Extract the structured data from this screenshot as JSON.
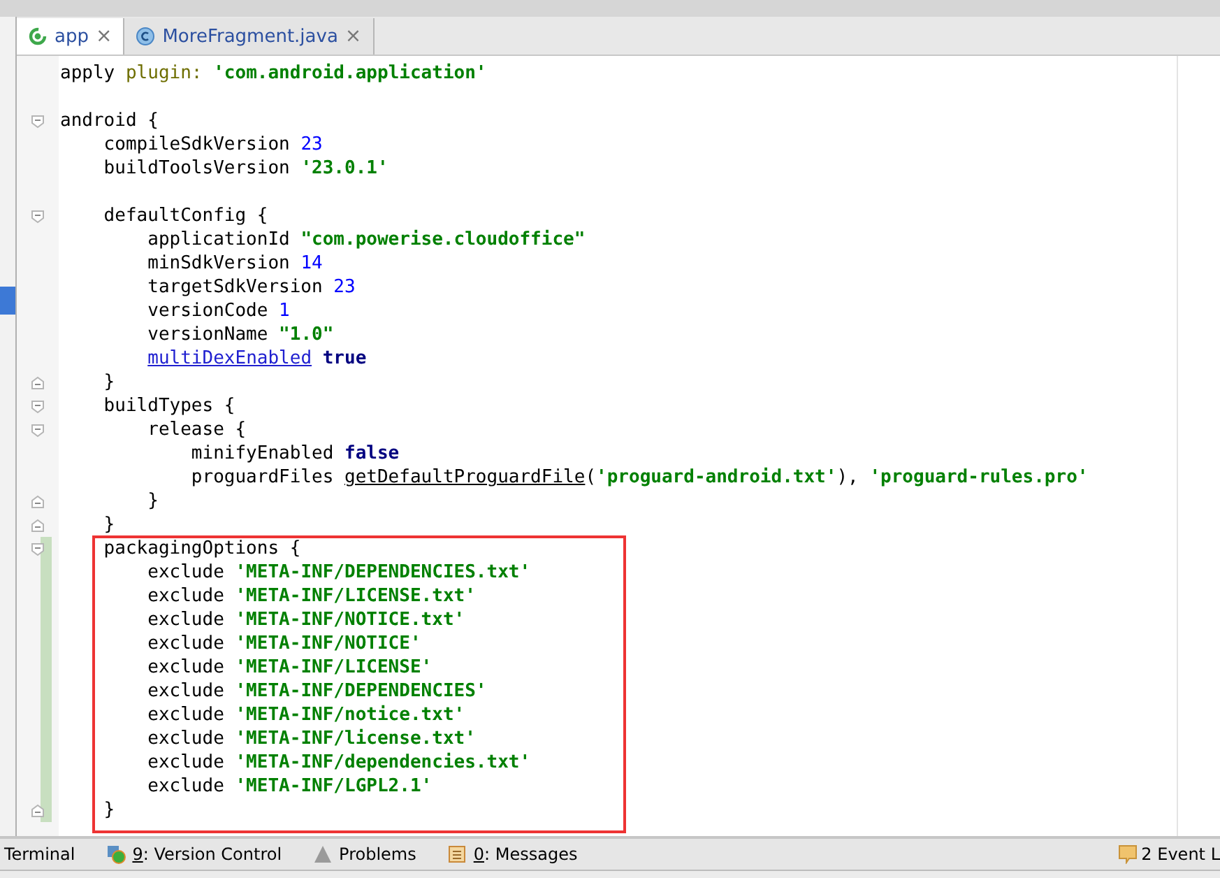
{
  "tabs": [
    {
      "label": "app",
      "kind": "gradle",
      "close": "×",
      "selected": true
    },
    {
      "label": "MoreFragment.java",
      "kind": "class",
      "close": "×",
      "selected": false
    }
  ],
  "code": {
    "lines": [
      {
        "kind": "code",
        "tokens": [
          {
            "kind": "plain",
            "text": "apply "
          },
          {
            "kind": "label",
            "text": "plugin: "
          },
          {
            "kind": "string",
            "text": "'com.android.application'"
          }
        ]
      },
      {
        "kind": "blank"
      },
      {
        "kind": "fold-open",
        "tokens": [
          {
            "kind": "plain",
            "text": "android {"
          }
        ]
      },
      {
        "kind": "code",
        "tokens": [
          {
            "kind": "plain",
            "text": "    compileSdkVersion "
          },
          {
            "kind": "number",
            "text": "23"
          }
        ]
      },
      {
        "kind": "code",
        "tokens": [
          {
            "kind": "plain",
            "text": "    buildToolsVersion "
          },
          {
            "kind": "string",
            "text": "'23.0.1'"
          }
        ]
      },
      {
        "kind": "blank"
      },
      {
        "kind": "fold-open",
        "tokens": [
          {
            "kind": "plain",
            "text": "    defaultConfig {"
          }
        ]
      },
      {
        "kind": "code",
        "tokens": [
          {
            "kind": "plain",
            "text": "        applicationId "
          },
          {
            "kind": "string",
            "text": "\"com.powerise.cloudoffice\""
          }
        ]
      },
      {
        "kind": "code",
        "tokens": [
          {
            "kind": "plain",
            "text": "        minSdkVersion "
          },
          {
            "kind": "number",
            "text": "14"
          }
        ]
      },
      {
        "kind": "code",
        "tokens": [
          {
            "kind": "plain",
            "text": "        targetSdkVersion "
          },
          {
            "kind": "number",
            "text": "23"
          }
        ]
      },
      {
        "kind": "code",
        "tokens": [
          {
            "kind": "plain",
            "text": "        versionCode "
          },
          {
            "kind": "number",
            "text": "1"
          }
        ]
      },
      {
        "kind": "code",
        "tokens": [
          {
            "kind": "plain",
            "text": "        versionName "
          },
          {
            "kind": "string",
            "text": "\"1.0\""
          }
        ]
      },
      {
        "kind": "code",
        "tokens": [
          {
            "kind": "link",
            "text": "        multiDexEnabled"
          },
          {
            "kind": "keyword",
            "text": " true"
          }
        ]
      },
      {
        "kind": "fold-close",
        "tokens": [
          {
            "kind": "plain",
            "text": "    }"
          }
        ]
      },
      {
        "kind": "fold-open",
        "tokens": [
          {
            "kind": "plain",
            "text": "    buildTypes {"
          }
        ]
      },
      {
        "kind": "fold-open",
        "tokens": [
          {
            "kind": "plain",
            "text": "        release {"
          }
        ]
      },
      {
        "kind": "code",
        "tokens": [
          {
            "kind": "plain",
            "text": "            minifyEnabled "
          },
          {
            "kind": "keyword",
            "text": "false"
          }
        ]
      },
      {
        "kind": "code",
        "tokens": [
          {
            "kind": "plain",
            "text": "            proguardFiles "
          },
          {
            "kind": "method",
            "text": "getDefaultProguardFile"
          },
          {
            "kind": "plain",
            "text": "("
          },
          {
            "kind": "string",
            "text": "'proguard-android.txt'"
          },
          {
            "kind": "plain",
            "text": "), "
          },
          {
            "kind": "string",
            "text": "'proguard-rules.pro'"
          }
        ]
      },
      {
        "kind": "fold-close",
        "tokens": [
          {
            "kind": "plain",
            "text": "        }"
          }
        ]
      },
      {
        "kind": "fold-close",
        "tokens": [
          {
            "kind": "plain",
            "text": "    }"
          }
        ]
      }
    ],
    "boxed_lines": [
      {
        "kind": "fold-open",
        "tokens": [
          {
            "kind": "plain",
            "text": "    packagingOptions {"
          }
        ]
      },
      {
        "kind": "code",
        "tokens": [
          {
            "kind": "plain",
            "text": "        exclude "
          },
          {
            "kind": "string",
            "text": "'META-INF/DEPENDENCIES.txt'"
          }
        ]
      },
      {
        "kind": "code",
        "tokens": [
          {
            "kind": "plain",
            "text": "        exclude "
          },
          {
            "kind": "string",
            "text": "'META-INF/LICENSE.txt'"
          }
        ]
      },
      {
        "kind": "code",
        "tokens": [
          {
            "kind": "plain",
            "text": "        exclude "
          },
          {
            "kind": "string",
            "text": "'META-INF/NOTICE.txt'"
          }
        ]
      },
      {
        "kind": "code",
        "tokens": [
          {
            "kind": "plain",
            "text": "        exclude "
          },
          {
            "kind": "string",
            "text": "'META-INF/NOTICE'"
          }
        ]
      },
      {
        "kind": "code",
        "tokens": [
          {
            "kind": "plain",
            "text": "        exclude "
          },
          {
            "kind": "string",
            "text": "'META-INF/LICENSE'"
          }
        ]
      },
      {
        "kind": "code",
        "tokens": [
          {
            "kind": "plain",
            "text": "        exclude "
          },
          {
            "kind": "string",
            "text": "'META-INF/DEPENDENCIES'"
          }
        ]
      },
      {
        "kind": "code",
        "tokens": [
          {
            "kind": "plain",
            "text": "        exclude "
          },
          {
            "kind": "string",
            "text": "'META-INF/notice.txt'"
          }
        ]
      },
      {
        "kind": "code",
        "tokens": [
          {
            "kind": "plain",
            "text": "        exclude "
          },
          {
            "kind": "string",
            "text": "'META-INF/license.txt'"
          }
        ]
      },
      {
        "kind": "code",
        "tokens": [
          {
            "kind": "plain",
            "text": "        exclude "
          },
          {
            "kind": "string",
            "text": "'META-INF/dependencies.txt'"
          }
        ]
      },
      {
        "kind": "code",
        "tokens": [
          {
            "kind": "plain",
            "text": "        exclude "
          },
          {
            "kind": "string",
            "text": "'META-INF/LGPL2.1'"
          }
        ]
      },
      {
        "kind": "fold-close",
        "tokens": [
          {
            "kind": "plain",
            "text": "    }"
          }
        ]
      }
    ]
  },
  "tool_windows": [
    {
      "label": "Terminal",
      "kind": "plain"
    },
    {
      "mnemonic": "9",
      "label": ": Version Control",
      "kind": "vcs"
    },
    {
      "label": "Problems",
      "kind": "warning"
    },
    {
      "mnemonic": "0",
      "label": ": Messages",
      "kind": "messages"
    }
  ],
  "event_log": {
    "count": "2",
    "label": "Event L"
  }
}
